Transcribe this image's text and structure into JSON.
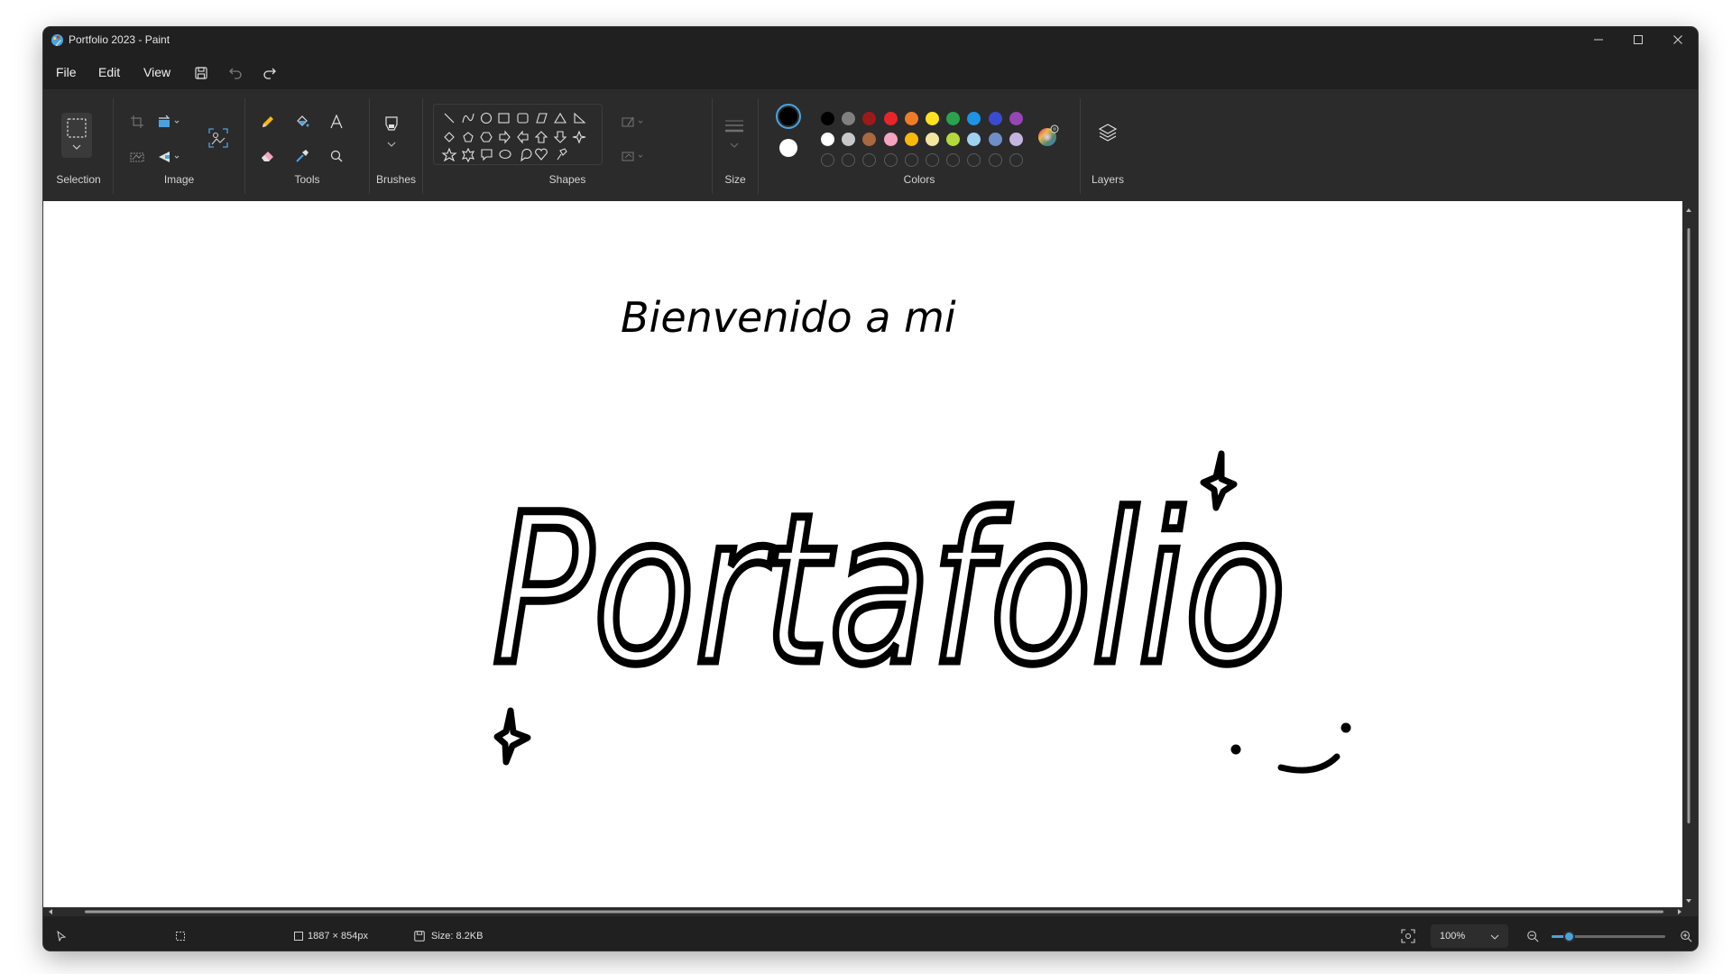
{
  "window": {
    "title": "Portfolio 2023 - Paint"
  },
  "menu": {
    "file": "File",
    "edit": "Edit",
    "view": "View"
  },
  "ribbon": {
    "groups": {
      "selection": "Selection",
      "image": "Image",
      "tools": "Tools",
      "brushes": "Brushes",
      "shapes": "Shapes",
      "size": "Size",
      "colors": "Colors",
      "layers": "Layers"
    },
    "primary_color": "#000000",
    "secondary_color": "#ffffff",
    "palette_row1": [
      "#000000",
      "#808080",
      "#9d1a1a",
      "#e8262a",
      "#f07c26",
      "#fde21f",
      "#2ba34c",
      "#1d93e5",
      "#3b4bd1",
      "#9646b5"
    ],
    "palette_row2": [
      "#ffffff",
      "#c8c8c8",
      "#a86840",
      "#f4a4c0",
      "#f7b90c",
      "#f2e6a2",
      "#b7d83c",
      "#9fd2ef",
      "#6f8ec9",
      "#c6b4e0"
    ]
  },
  "canvas": {
    "greeting": "Bienvenido a mi",
    "title": "Portafolio"
  },
  "status": {
    "dimensions": "1887 × 854px",
    "size": "Size: 8.2KB",
    "zoom": "100%",
    "zoom_level": 0.15
  }
}
